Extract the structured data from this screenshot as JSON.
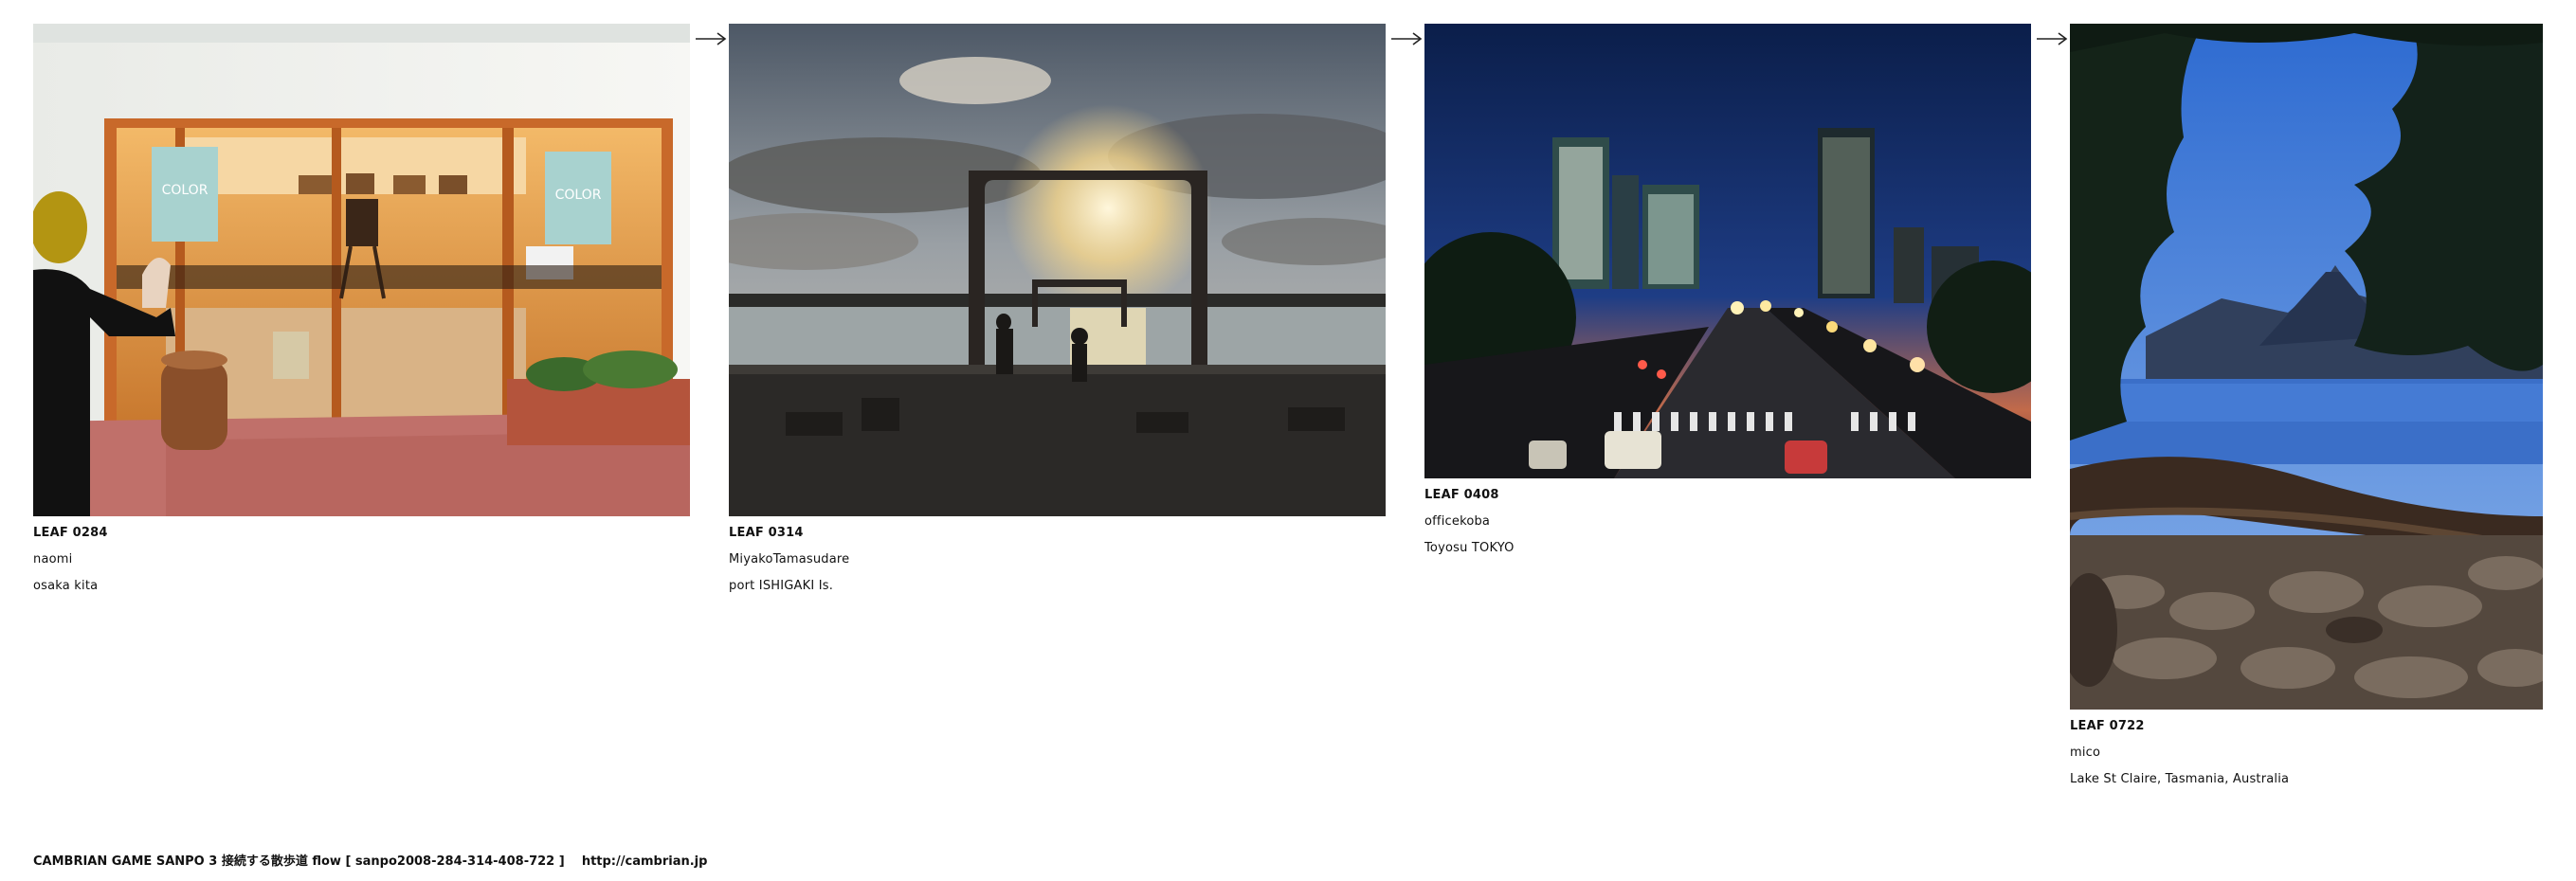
{
  "leaves": [
    {
      "code": "LEAF 0284",
      "author": "naomi",
      "place": "osaka kita",
      "poster_text": "COLOR",
      "photo_desc_icon": "gallery-storefront-photo"
    },
    {
      "code": "LEAF 0314",
      "author": "MiyakoTamasudare",
      "place": "port ISHIGAKI Is.",
      "photo_desc_icon": "harbor-sunset-photo"
    },
    {
      "code": "LEAF 0408",
      "author": "officekoba",
      "place": "Toyosu TOKYO",
      "photo_desc_icon": "city-night-photo"
    },
    {
      "code": "LEAF 0722",
      "author": "mico",
      "place": "Lake St Claire, Tasmania, Australia",
      "photo_desc_icon": "lake-mountain-photo"
    }
  ],
  "arrow_icon": "right-arrow-icon",
  "footer": {
    "title": "CAMBRIAN GAME  SANPO 3 接続する散歩道 flow [ sanpo2008-284-314-408-722 ]",
    "url": "http://cambrian.jp"
  }
}
